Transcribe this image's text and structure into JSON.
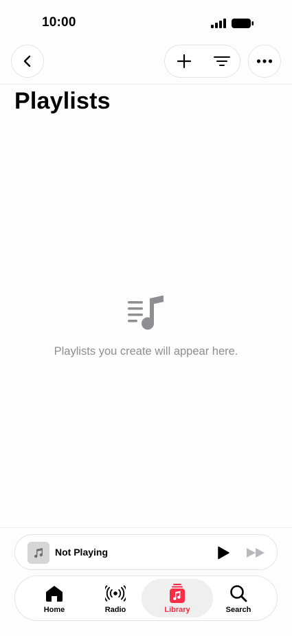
{
  "status_bar": {
    "time": "10:00",
    "icons": [
      "signal-icon",
      "battery-icon"
    ]
  },
  "header": {
    "back_icon": "chevron-left-icon",
    "add_icon": "plus-icon",
    "sort_icon": "sort-lines-icon",
    "more_icon": "ellipsis-icon"
  },
  "page": {
    "title": "Playlists"
  },
  "empty_state": {
    "icon": "music-playlist-icon",
    "message": "Playlists you create will appear here."
  },
  "mini_player": {
    "art_icon": "music-note-icon",
    "title": "Not Playing",
    "play_icon": "play-icon",
    "forward_icon": "fast-forward-icon"
  },
  "tab_bar": {
    "tabs": [
      {
        "label": "Home",
        "icon": "home-icon",
        "active": false
      },
      {
        "label": "Radio",
        "icon": "radio-waves-icon",
        "active": false
      },
      {
        "label": "Library",
        "icon": "library-icon",
        "active": true
      },
      {
        "label": "Search",
        "icon": "magnifier-icon",
        "active": false
      }
    ]
  },
  "colors": {
    "accent": "#fa2d48",
    "secondary_text": "#8e8e93",
    "icon_gray": "#8e8e93",
    "background": "#fdfdfd"
  }
}
